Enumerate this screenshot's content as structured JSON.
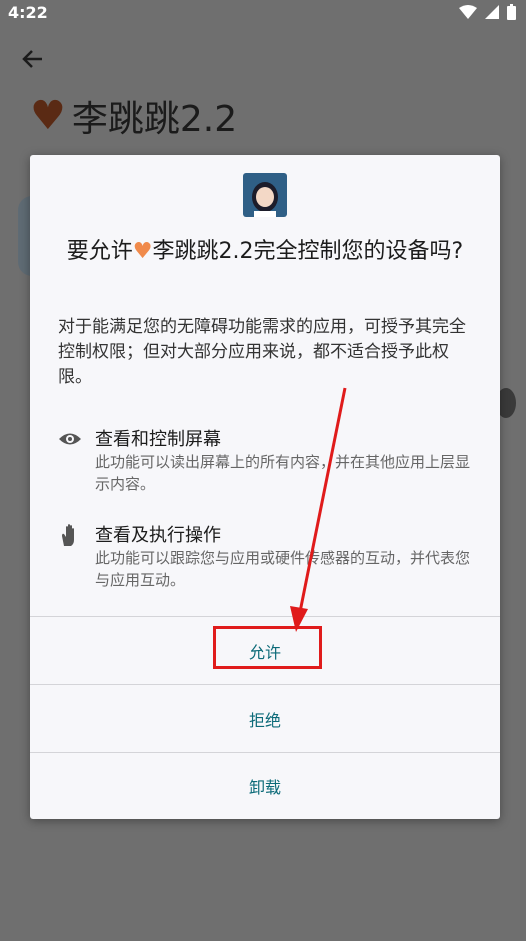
{
  "status": {
    "time": "4:22"
  },
  "background": {
    "app_title": "李跳跳2.2",
    "back_icon": "arrow-left-icon"
  },
  "dialog": {
    "title_prefix": "要允许",
    "title_app": "李跳跳2.2",
    "title_suffix": "完全控制您的设备吗?",
    "description": "对于能满足您的无障碍功能需求的应用，可授予其完全控制权限；但对大部分应用来说，都不适合授予此权限。",
    "permissions": [
      {
        "icon": "eye-icon",
        "title": "查看和控制屏幕",
        "desc": "此功能可以读出屏幕上的所有内容，并在其他应用上层显示内容。"
      },
      {
        "icon": "hand-icon",
        "title": "查看及执行操作",
        "desc": "此功能可以跟踪您与应用或硬件传感器的互动，并代表您与应用互动。"
      }
    ],
    "buttons": {
      "allow": "允许",
      "deny": "拒绝",
      "uninstall": "卸载"
    }
  },
  "colors": {
    "accent": "#0b6a78",
    "highlight": "#e01b1b",
    "heart": "#f08a4b"
  }
}
